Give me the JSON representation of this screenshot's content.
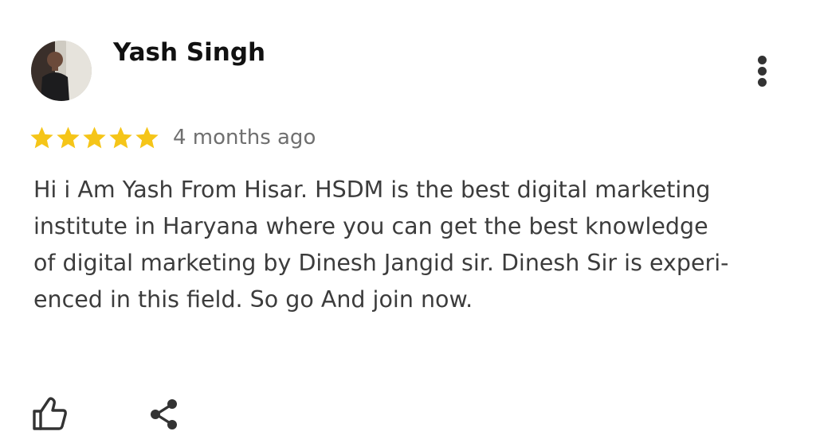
{
  "review": {
    "reviewer_name": "Yash Singh",
    "rating": 5,
    "max_rating": 5,
    "date": "4 months ago",
    "text": "Hi i Am Yash From Hisar. HSDM is the best digital marketing\ninstitute in Haryana where you can get the best knowledge\nof digital marketing by Dinesh Jangid sir. Dinesh Sir is experi-\nenced in this field. So go And join now."
  },
  "icons": {
    "menu": "more-vert-icon",
    "like": "thumbs-up-icon",
    "share": "share-icon",
    "star": "star-icon"
  },
  "colors": {
    "star": "#F5C518",
    "name": "#111111",
    "text": "#3C3C3C",
    "date": "#6F6F6F",
    "icon": "#333333"
  }
}
